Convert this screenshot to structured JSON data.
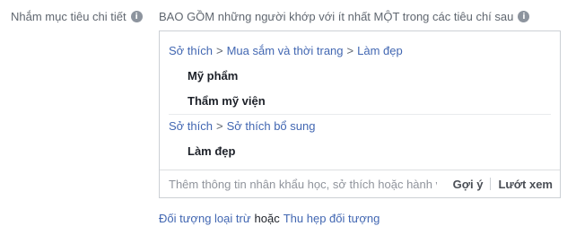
{
  "detailed_targeting": {
    "label": "Nhắm mục tiêu chi tiết",
    "info_glyph": "i"
  },
  "include": {
    "title": "BAO GỒM những người khớp với ít nhất MỘT trong các tiêu chí sau",
    "info_glyph": "i"
  },
  "groups": [
    {
      "breadcrumb": [
        "Sở thích",
        "Mua sắm và thời trang",
        "Làm đẹp"
      ],
      "items": [
        "Mỹ phẩm",
        "Thẩm mỹ viện"
      ]
    },
    {
      "breadcrumb": [
        "Sở thích",
        "Sở thích bổ sung"
      ],
      "items": [
        "Làm đẹp"
      ]
    }
  ],
  "breadcrumb_separator": ">",
  "search": {
    "placeholder": "Thêm thông tin nhân khẩu học, sở thích hoặc hành vi",
    "suggest_label": "Gợi ý",
    "browse_label": "Lướt xem"
  },
  "footer": {
    "exclude_link": "Đối tượng loại trừ",
    "or_text": "hoặc",
    "narrow_link": "Thu hẹp đối tượng"
  },
  "colors": {
    "link": "#4267b2",
    "muted": "#606770",
    "border": "#ccd0d5"
  }
}
